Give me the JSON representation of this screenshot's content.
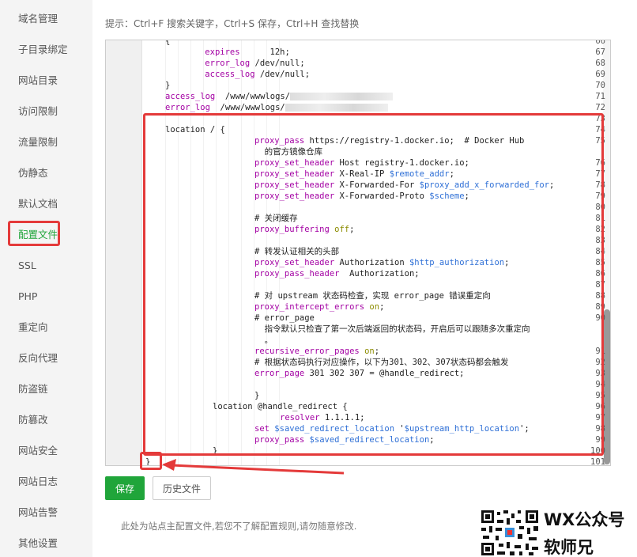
{
  "sidebar": {
    "items": [
      {
        "label": "域名管理"
      },
      {
        "label": "子目录绑定"
      },
      {
        "label": "网站目录"
      },
      {
        "label": "访问限制"
      },
      {
        "label": "流量限制"
      },
      {
        "label": "伪静态"
      },
      {
        "label": "默认文档"
      },
      {
        "label": "配置文件",
        "active": true
      },
      {
        "label": "SSL"
      },
      {
        "label": "PHP"
      },
      {
        "label": "重定向"
      },
      {
        "label": "反向代理"
      },
      {
        "label": "防盗链"
      },
      {
        "label": "防篡改"
      },
      {
        "label": "网站安全"
      },
      {
        "label": "网站日志"
      },
      {
        "label": "网站告警"
      },
      {
        "label": "其他设置"
      }
    ]
  },
  "tip": "提示：Ctrl+F 搜索关键字，Ctrl+S 保存，Ctrl+H 查找替换",
  "editor": {
    "lines": [
      {
        "n": "66",
        "text": "{"
      },
      {
        "n": "67",
        "text": "    expires      12h;"
      },
      {
        "n": "68",
        "text": "    error_log /dev/null;"
      },
      {
        "n": "69",
        "text": "    access_log /dev/null;"
      },
      {
        "n": "70",
        "text": "}"
      },
      {
        "n": "71",
        "text": "access_log  /www/wwwlogs/"
      },
      {
        "n": "72",
        "text": "error_log  /www/wwwlogs/"
      },
      {
        "n": "73",
        "text": ""
      },
      {
        "n": "74",
        "text": "location / {"
      },
      {
        "n": "75",
        "text": "proxy_pass https://registry-1.docker.io;  # Docker Hub"
      },
      {
        "n": "",
        "text": "  的官方镜像仓库"
      },
      {
        "n": "76",
        "text": "proxy_set_header Host registry-1.docker.io;"
      },
      {
        "n": "77",
        "text": "proxy_set_header X-Real-IP $remote_addr;"
      },
      {
        "n": "78",
        "text": "proxy_set_header X-Forwarded-For $proxy_add_x_forwarded_for;"
      },
      {
        "n": "79",
        "text": "proxy_set_header X-Forwarded-Proto $scheme;"
      },
      {
        "n": "80",
        "text": ""
      },
      {
        "n": "81",
        "text": "# 关闭缓存"
      },
      {
        "n": "82",
        "text": "proxy_buffering off;"
      },
      {
        "n": "83",
        "text": ""
      },
      {
        "n": "84",
        "text": "# 转发认证相关的头部"
      },
      {
        "n": "85",
        "text": "proxy_set_header Authorization $http_authorization;"
      },
      {
        "n": "86",
        "text": "proxy_pass_header  Authorization;"
      },
      {
        "n": "87",
        "text": ""
      },
      {
        "n": "88",
        "text": "# 对 upstream 状态码检查，实现 error_page 错误重定向"
      },
      {
        "n": "89",
        "text": "proxy_intercept_errors on;"
      },
      {
        "n": "90",
        "text": "# error_page"
      },
      {
        "n": "",
        "text": "  指令默认只检查了第一次后端返回的状态码，开启后可以跟随多次重定向"
      },
      {
        "n": "",
        "text": "  。"
      },
      {
        "n": "91",
        "text": "recursive_error_pages on;"
      },
      {
        "n": "92",
        "text": "# 根据状态码执行对应操作，以下为301、302、307状态码都会触发"
      },
      {
        "n": "93",
        "text": "error_page 301 302 307 = @handle_redirect;"
      },
      {
        "n": "94",
        "text": ""
      },
      {
        "n": "95",
        "text": "}"
      },
      {
        "n": "96",
        "text": "location @handle_redirect {"
      },
      {
        "n": "97",
        "text": "resolver 1.1.1.1;"
      },
      {
        "n": "98",
        "text": "set $saved_redirect_location '$upstream_http_location';"
      },
      {
        "n": "99",
        "text": "proxy_pass $saved_redirect_location;"
      },
      {
        "n": "100",
        "text": "}"
      },
      {
        "n": "101",
        "text": "}"
      }
    ]
  },
  "buttons": {
    "save": "保存",
    "history": "历史文件"
  },
  "note": "此处为站点主配置文件,若您不了解配置规则,请勿随意修改.",
  "watermark": {
    "line1": "WX公众号",
    "line2": "软师兄"
  },
  "colors": {
    "accent": "#20a53a",
    "highlight": "#e43a3a"
  }
}
